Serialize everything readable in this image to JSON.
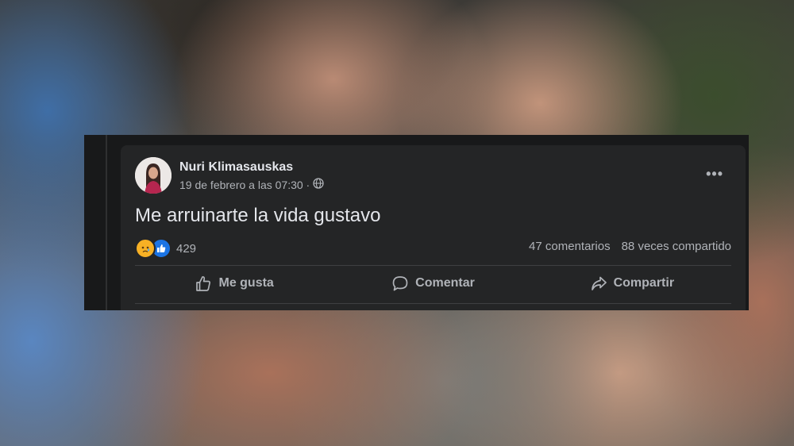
{
  "post": {
    "author": "Nuri Klimasauskas",
    "timestamp": "19 de febrero a las 07:30 ·",
    "privacy_icon": "globe-icon",
    "text": "Me arruinarte la vida gustavo",
    "reactions": {
      "icons": [
        "sad-reaction-icon",
        "like-reaction-icon"
      ],
      "count": "429"
    },
    "comments": "47 comentarios",
    "shares": "88 veces compartido"
  },
  "actions": {
    "like": "Me gusta",
    "comment": "Comentar",
    "share": "Compartir"
  },
  "colors": {
    "card_bg": "#242526",
    "frame_bg": "#18191a",
    "text_primary": "#e4e6eb",
    "text_secondary": "#b0b3b8",
    "sad_yellow": "#f7b125",
    "like_blue": "#1b74e4"
  }
}
